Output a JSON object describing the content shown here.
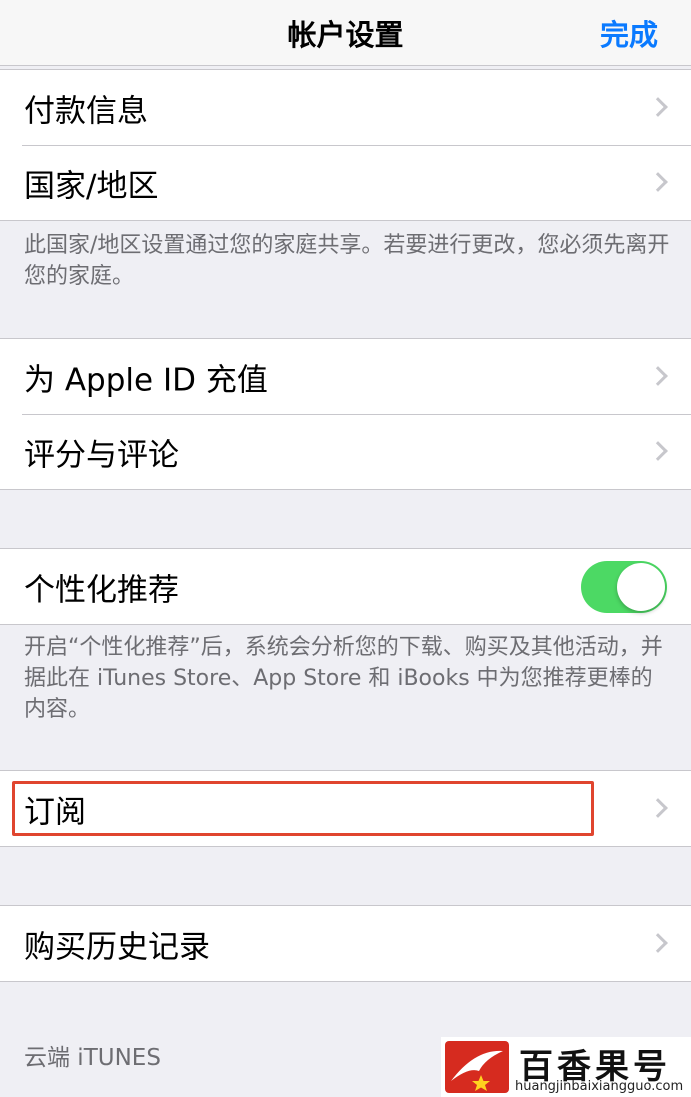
{
  "nav": {
    "title": "帐户设置",
    "done": "完成"
  },
  "group1": [
    {
      "label": "付款信息"
    },
    {
      "label": "国家/地区"
    }
  ],
  "note1": "此国家/地区设置通过您的家庭共享。若要进行更改，您必须先离开您的家庭。",
  "group2": [
    {
      "label": "为 Apple ID 充值"
    },
    {
      "label": "评分与评论"
    }
  ],
  "personalization": {
    "label": "个性化推荐",
    "enabled": true
  },
  "note2": "开启“个性化推荐”后，系统会分析您的下载、购买及其他活动，并据此在 iTunes Store、App Store 和 iBooks 中为您推荐更棒的内容。",
  "subscriptions": {
    "label": "订阅"
  },
  "purchase_history": {
    "label": "购买历史记录"
  },
  "cloud_section_header": "云端 iTUNES",
  "watermark": {
    "title": "百香果号",
    "url": "huangjinbaixiangguo.com"
  },
  "colors": {
    "accent": "#0a7aff",
    "toggle_on": "#4cd964",
    "highlight": "#e0452f"
  }
}
